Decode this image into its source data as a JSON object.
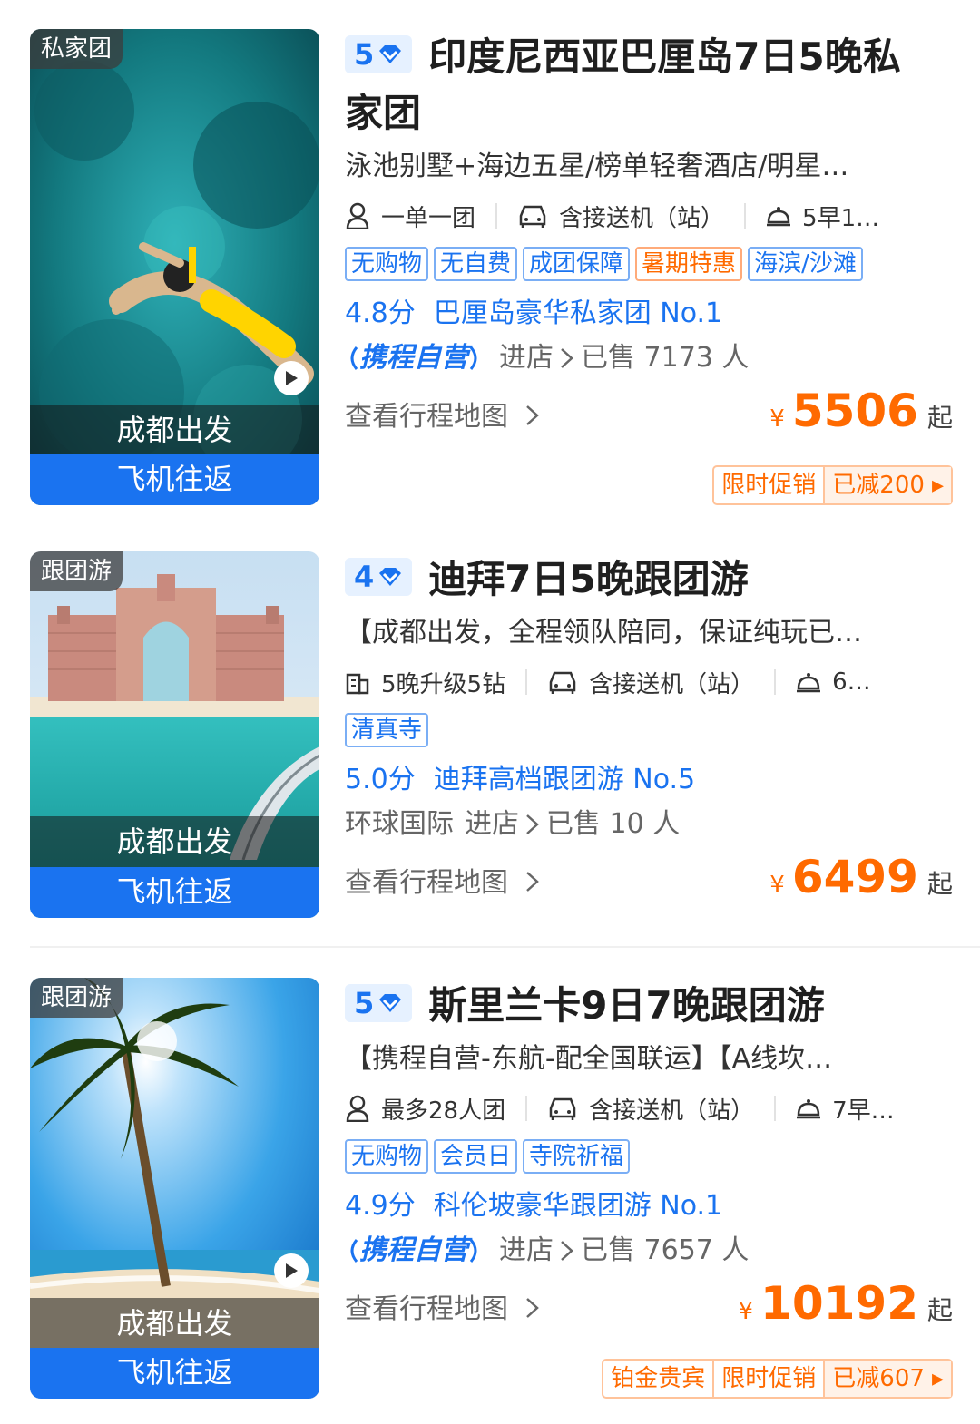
{
  "products": [
    {
      "badge": "私家团",
      "departure": "成都出发",
      "transport": "飞机往返",
      "has_video": true,
      "level": "5",
      "title_line1": "印度尼西亚巴厘岛7日5晚私",
      "title_line2": "家团",
      "subtitle": "泳池别墅+海边五星/榜单轻奢酒店/明星…",
      "features": [
        "一单一团",
        "含接送机（站）",
        "5早1…"
      ],
      "tags": [
        {
          "label": "无购物",
          "style": "blue"
        },
        {
          "label": "无自费",
          "style": "blue"
        },
        {
          "label": "成团保障",
          "style": "blue"
        },
        {
          "label": "暑期特惠",
          "style": "orange"
        },
        {
          "label": "海滨/沙滩",
          "style": "blue"
        }
      ],
      "score": "4.8分",
      "rank": "巴厘岛豪华私家团 No.1",
      "vendor": "携程自营",
      "shop_text": "进店",
      "sold": "已售 7173 人",
      "map_link": "查看行程地图",
      "currency": "¥",
      "price": "5506",
      "price_suffix": "起",
      "promo": [
        "限时促销",
        "已减200"
      ]
    },
    {
      "badge": "跟团游",
      "departure": "成都出发",
      "transport": "飞机往返",
      "has_video": false,
      "level": "4",
      "title_line1": "迪拜7日5晚跟团游",
      "subtitle": "【成都出发，全程领队陪同，保证纯玩已…",
      "features": [
        "5晚升级5钻",
        "含接送机（站）",
        "6…"
      ],
      "tags": [
        {
          "label": "清真寺",
          "style": "blue"
        }
      ],
      "score": "5.0分",
      "rank": "迪拜高档跟团游 No.5",
      "vendor": "环球国际",
      "shop_text": "进店",
      "sold": "已售 10 人",
      "map_link": "查看行程地图",
      "currency": "¥",
      "price": "6499",
      "price_suffix": "起"
    },
    {
      "badge": "跟团游",
      "departure": "成都出发",
      "transport": "飞机往返",
      "has_video": true,
      "level": "5",
      "title_line1": "斯里兰卡9日7晚跟团游",
      "subtitle": "【携程自营-东航-配全国联运】【A线坎…",
      "features": [
        "最多28人团",
        "含接送机（站）",
        "7早…"
      ],
      "tags": [
        {
          "label": "无购物",
          "style": "blue"
        },
        {
          "label": "会员日",
          "style": "blue"
        },
        {
          "label": "寺院祈福",
          "style": "blue"
        }
      ],
      "score": "4.9分",
      "rank": "科伦坡豪华跟团游 No.1",
      "vendor": "携程自营",
      "shop_text": "进店",
      "sold": "已售 7657 人",
      "map_link": "查看行程地图",
      "currency": "¥",
      "price": "10192",
      "price_suffix": "起",
      "promo": [
        "铂金贵宾",
        "限时促销",
        "已减607"
      ]
    }
  ],
  "colors": {
    "accent": "#1a73f0",
    "price": "#ff6a00",
    "tag_bg": "#e6f1ff"
  }
}
